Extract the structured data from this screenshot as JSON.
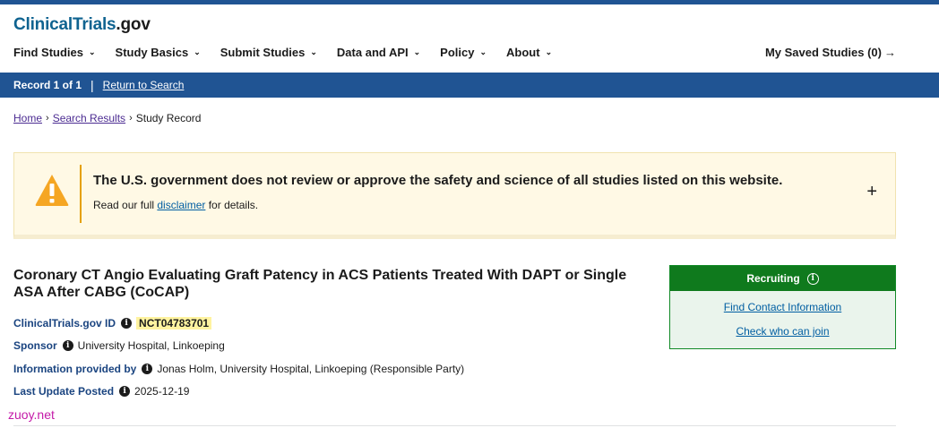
{
  "logo": {
    "brand": "ClinicalTrials",
    "suffix": ".gov"
  },
  "nav": {
    "items": [
      {
        "label": "Find Studies"
      },
      {
        "label": "Study Basics"
      },
      {
        "label": "Submit Studies"
      },
      {
        "label": "Data and API"
      },
      {
        "label": "Policy"
      },
      {
        "label": "About"
      }
    ],
    "chevron": "⌄",
    "saved": "My Saved Studies (0)",
    "saved_arrow": "→"
  },
  "record_bar": {
    "record": "Record 1 of 1",
    "separator": "|",
    "return_link": "Return to Search"
  },
  "breadcrumb": {
    "home": "Home",
    "search_results": "Search Results",
    "current": "Study Record",
    "sep": "›"
  },
  "alert": {
    "title": "The U.S. government does not review or approve the safety and science of all studies listed on this website.",
    "text_before": "Read our full ",
    "link": "disclaimer",
    "text_after": " for details.",
    "expand": "+"
  },
  "study": {
    "title": "Coronary CT Angio Evaluating Graft Patency in ACS Patients Treated With DAPT or Single ASA After CABG (CoCAP)",
    "id_label": "ClinicalTrials.gov ID",
    "id_value": "NCT04783701",
    "sponsor_label": "Sponsor",
    "sponsor_value": "University Hospital, Linkoeping",
    "provided_label": "Information provided by",
    "provided_value": "Jonas Holm, University Hospital, Linkoeping (Responsible Party)",
    "updated_label": "Last Update Posted",
    "updated_value": "2025-12-19"
  },
  "recruit": {
    "status": "Recruiting",
    "contact_link": "Find Contact Information",
    "check_link": "Check who can join"
  },
  "watermark": "zuoy.net",
  "colors": {
    "primary": "#205493",
    "recruiting": "#0f7a1d",
    "alert_bg": "#fff9e5",
    "warning": "#f5a623",
    "link": "#005ea2",
    "visited_link": "#4c2c92"
  }
}
